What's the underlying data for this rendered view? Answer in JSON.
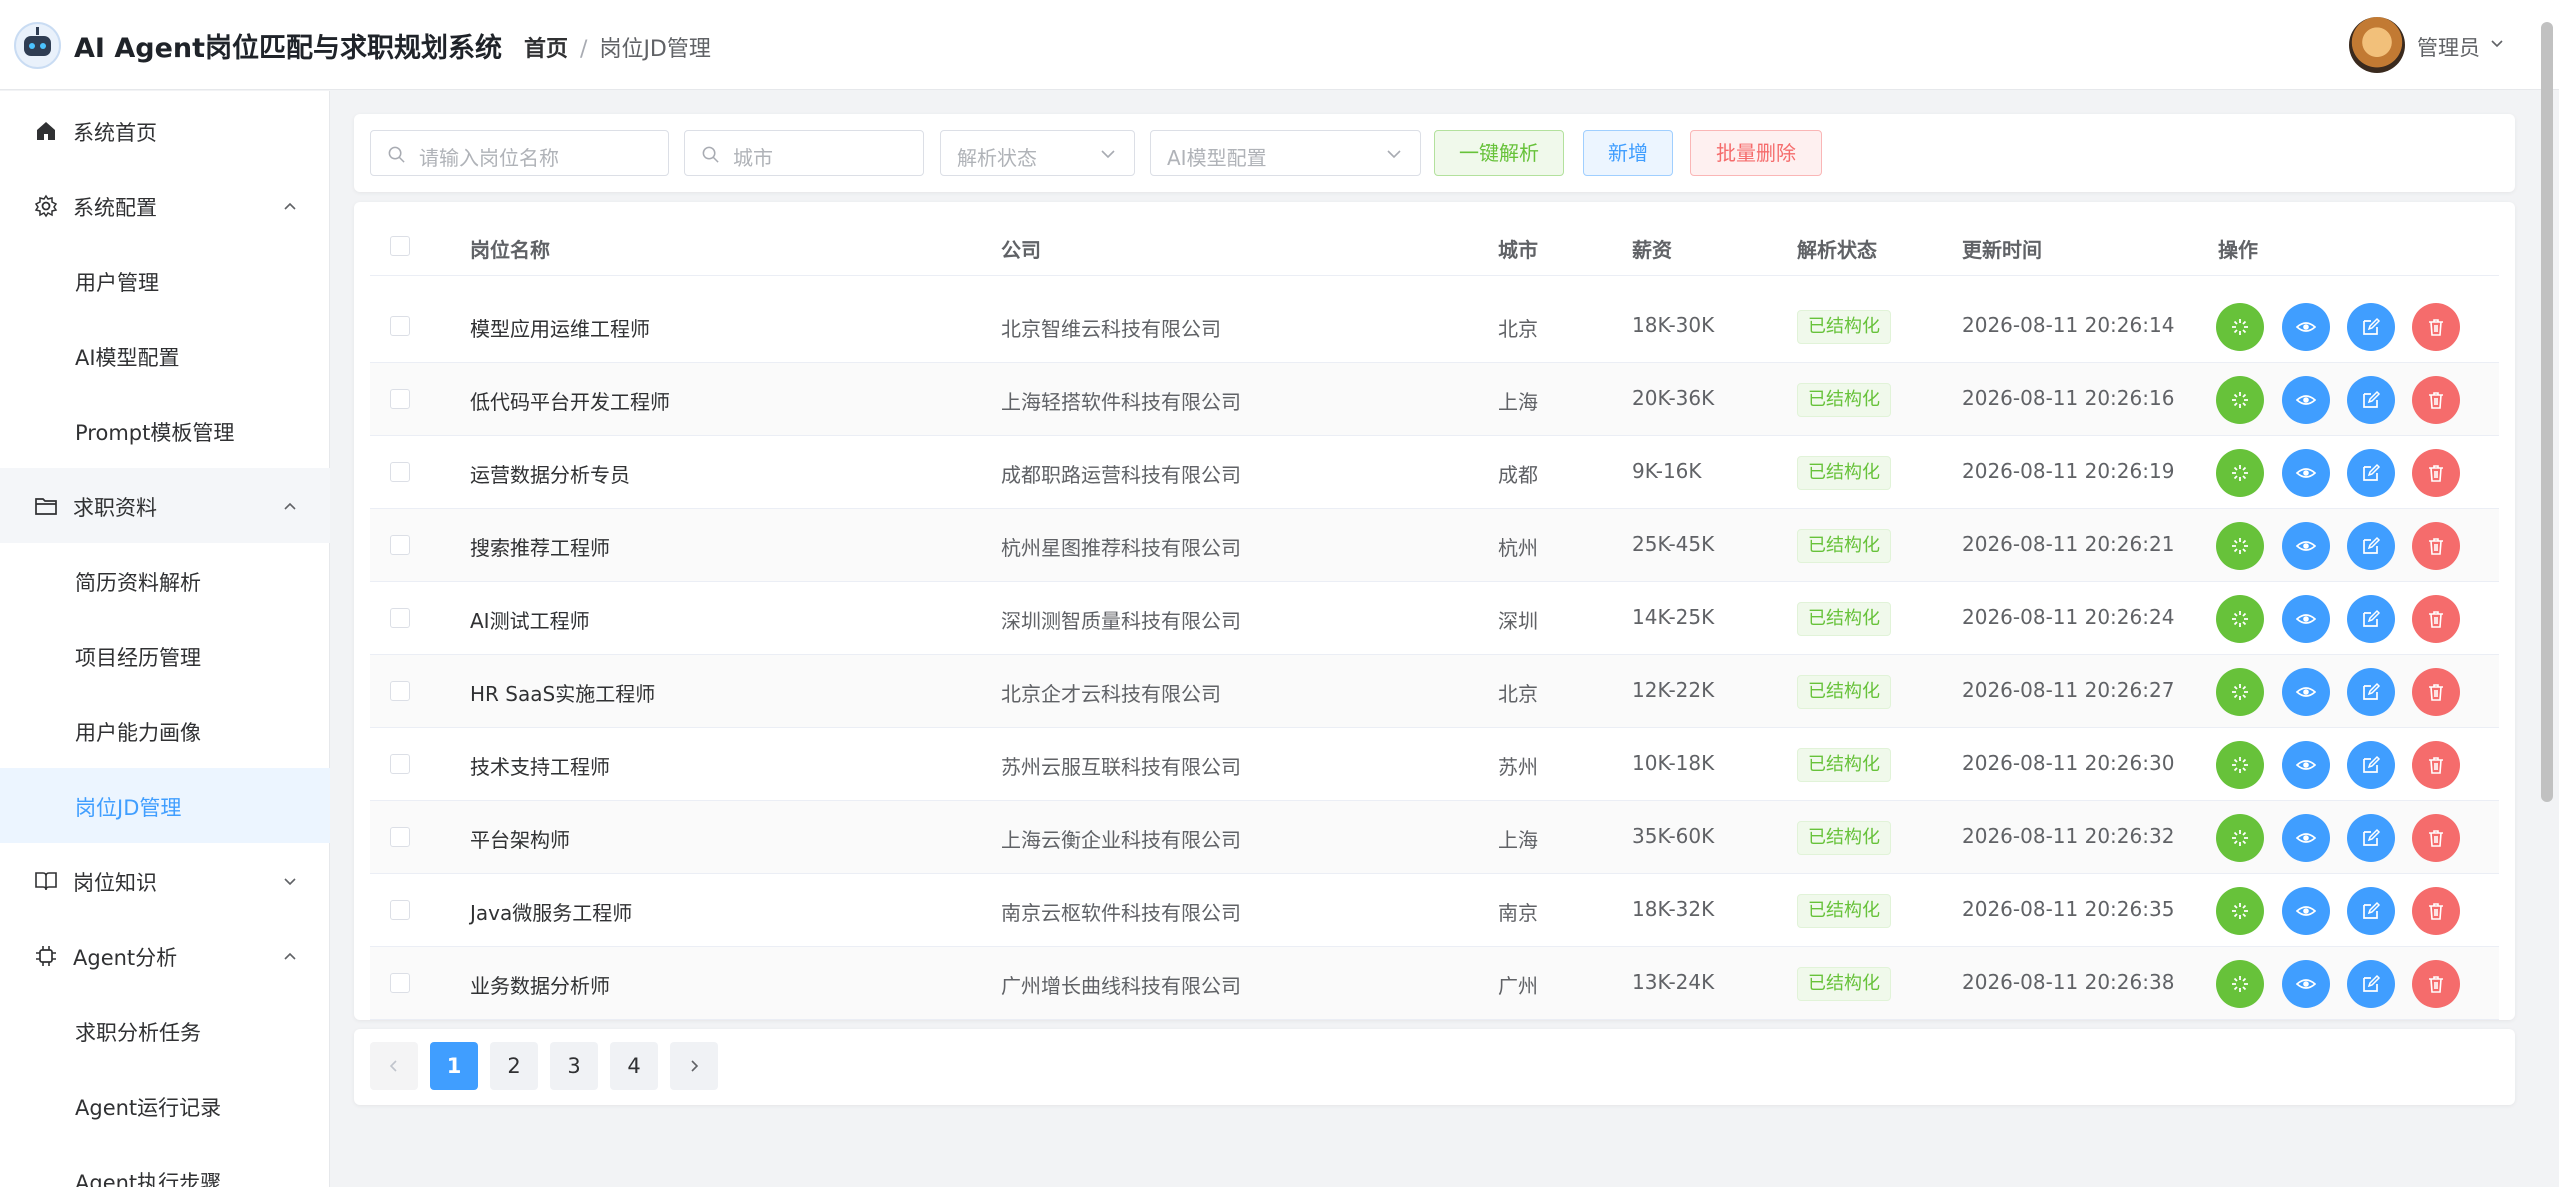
{
  "header": {
    "app_title": "AI Agent岗位匹配与求职规划系统",
    "breadcrumb": [
      "首页",
      "岗位JD管理"
    ],
    "user_name": "管理员"
  },
  "sidebar": {
    "items": [
      {
        "label": "系统首页",
        "icon": "home-icon"
      },
      {
        "label": "系统配置",
        "icon": "gear-icon",
        "expanded": true
      },
      {
        "label": "用户管理"
      },
      {
        "label": "AI模型配置"
      },
      {
        "label": "Prompt模板管理"
      },
      {
        "label": "求职资料",
        "icon": "folder-icon",
        "expanded": true
      },
      {
        "label": "简历资料解析"
      },
      {
        "label": "项目经历管理"
      },
      {
        "label": "用户能力画像"
      },
      {
        "label": "岗位JD管理",
        "active": true
      },
      {
        "label": "岗位知识",
        "icon": "book-icon",
        "expanded": false
      },
      {
        "label": "Agent分析",
        "icon": "cpu-icon",
        "expanded": true
      },
      {
        "label": "求职分析任务"
      },
      {
        "label": "Agent运行记录"
      },
      {
        "label": "Agent执行步骤"
      }
    ]
  },
  "toolbar": {
    "search_placeholder": "请输入岗位名称",
    "city_placeholder": "城市",
    "parse_status_placeholder": "解析状态",
    "ai_model_placeholder": "AI模型配置",
    "parse_all_label": "一键解析",
    "add_label": "新增",
    "batch_delete_label": "批量删除"
  },
  "table": {
    "columns": [
      "岗位名称",
      "公司",
      "城市",
      "薪资",
      "解析状态",
      "更新时间",
      "操作"
    ],
    "rows": [
      {
        "name": "模型应用运维工程师",
        "company": "北京智维云科技有限公司",
        "city": "北京",
        "salary": "18K-30K",
        "status": "已结构化",
        "updated": "2026-08-11 20:26:14"
      },
      {
        "name": "低代码平台开发工程师",
        "company": "上海轻搭软件科技有限公司",
        "city": "上海",
        "salary": "20K-36K",
        "status": "已结构化",
        "updated": "2026-08-11 20:26:16"
      },
      {
        "name": "运营数据分析专员",
        "company": "成都职路运营科技有限公司",
        "city": "成都",
        "salary": "9K-16K",
        "status": "已结构化",
        "updated": "2026-08-11 20:26:19"
      },
      {
        "name": "搜索推荐工程师",
        "company": "杭州星图推荐科技有限公司",
        "city": "杭州",
        "salary": "25K-45K",
        "status": "已结构化",
        "updated": "2026-08-11 20:26:21"
      },
      {
        "name": "AI测试工程师",
        "company": "深圳测智质量科技有限公司",
        "city": "深圳",
        "salary": "14K-25K",
        "status": "已结构化",
        "updated": "2026-08-11 20:26:24"
      },
      {
        "name": "HR SaaS实施工程师",
        "company": "北京企才云科技有限公司",
        "city": "北京",
        "salary": "12K-22K",
        "status": "已结构化",
        "updated": "2026-08-11 20:26:27"
      },
      {
        "name": "技术支持工程师",
        "company": "苏州云服互联科技有限公司",
        "city": "苏州",
        "salary": "10K-18K",
        "status": "已结构化",
        "updated": "2026-08-11 20:26:30"
      },
      {
        "name": "平台架构师",
        "company": "上海云衡企业科技有限公司",
        "city": "上海",
        "salary": "35K-60K",
        "status": "已结构化",
        "updated": "2026-08-11 20:26:32"
      },
      {
        "name": "Java微服务工程师",
        "company": "南京云枢软件科技有限公司",
        "city": "南京",
        "salary": "18K-32K",
        "status": "已结构化",
        "updated": "2026-08-11 20:26:35"
      },
      {
        "name": "业务数据分析师",
        "company": "广州增长曲线科技有限公司",
        "city": "广州",
        "salary": "13K-24K",
        "status": "已结构化",
        "updated": "2026-08-11 20:26:38"
      }
    ]
  },
  "pagination": {
    "pages": [
      "1",
      "2",
      "3",
      "4"
    ],
    "current": "1"
  },
  "colors": {
    "primary": "#409eff",
    "success": "#67c23a",
    "danger": "#f56c6c"
  }
}
